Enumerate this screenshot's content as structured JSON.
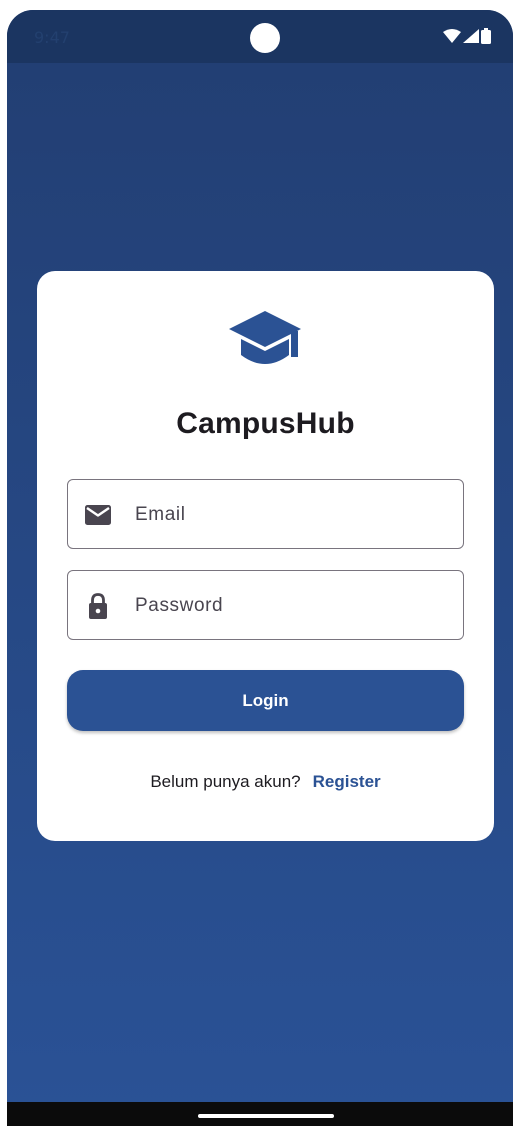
{
  "status_bar": {
    "time": "9:47",
    "icons": [
      "wifi-icon",
      "signal-icon",
      "battery-icon"
    ]
  },
  "app": {
    "name": "CampusHub",
    "logo_icon": "graduation-cap-icon"
  },
  "form": {
    "email": {
      "label": "Email",
      "icon": "mail-icon"
    },
    "password": {
      "label": "Password",
      "icon": "lock-icon"
    },
    "login_label": "Login"
  },
  "register": {
    "prompt": "Belum punya akun?",
    "link_label": "Register"
  },
  "colors": {
    "primary": "#2b5294",
    "background_top": "#223e72",
    "background_bottom": "#2a5296",
    "card": "#ffffff"
  }
}
